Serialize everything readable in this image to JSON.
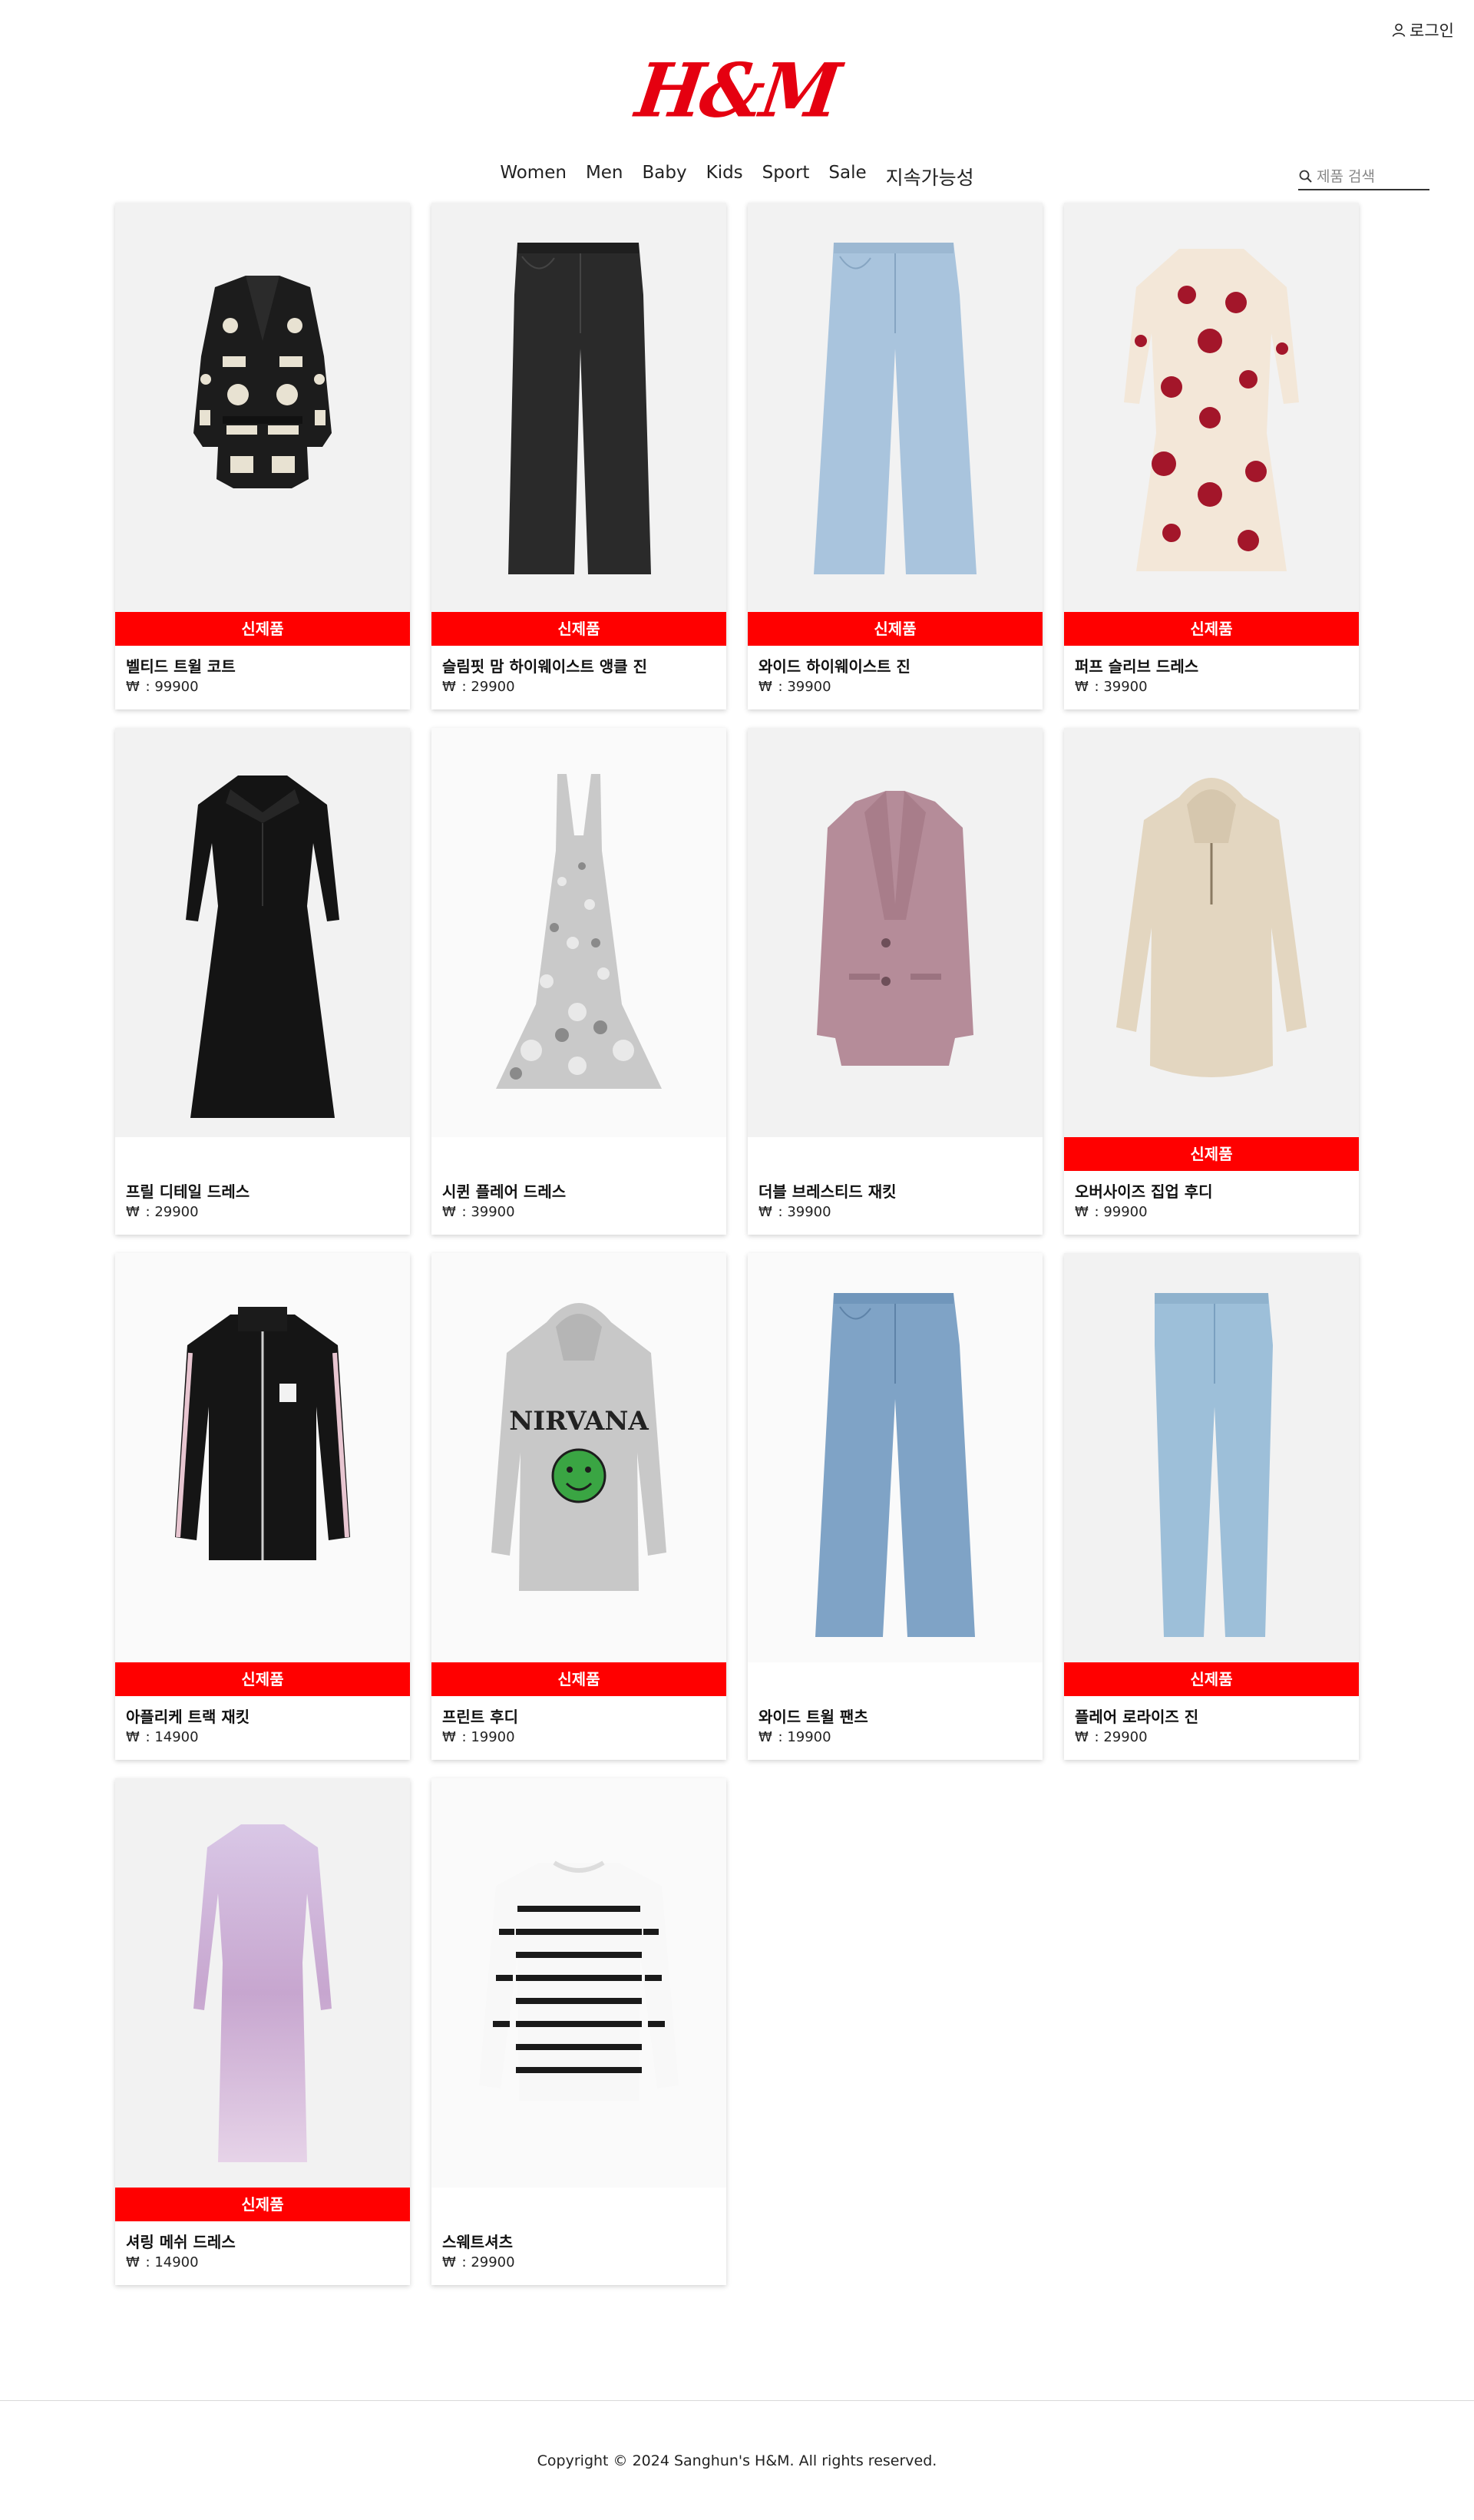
{
  "header": {
    "login_label": "로그인",
    "logo_text": "H&M",
    "brand_color": "#e50010"
  },
  "nav": {
    "items": [
      "Women",
      "Men",
      "Baby",
      "Kids",
      "Sport",
      "Sale",
      "지속가능성"
    ]
  },
  "search": {
    "placeholder": "제품 검색",
    "value": ""
  },
  "products": [
    {
      "name": "벨티드 트윌 코트",
      "currency": "₩",
      "price": "99900",
      "is_new": true,
      "badge": "신제품",
      "image": "patterned-jacket"
    },
    {
      "name": "슬림핏 맘 하이웨이스트 앵클 진",
      "currency": "₩",
      "price": "29900",
      "is_new": true,
      "badge": "신제품",
      "image": "black-jeans"
    },
    {
      "name": "와이드 하이웨이스트 진",
      "currency": "₩",
      "price": "39900",
      "is_new": true,
      "badge": "신제품",
      "image": "light-wide-jeans"
    },
    {
      "name": "퍼프 슬리브 드레스",
      "currency": "₩",
      "price": "39900",
      "is_new": true,
      "badge": "신제품",
      "image": "red-print-dress"
    },
    {
      "name": "프릴 디테일 드레스",
      "currency": "₩",
      "price": "29900",
      "is_new": false,
      "badge": "",
      "image": "black-dress"
    },
    {
      "name": "시퀸 플레어 드레스",
      "currency": "₩",
      "price": "39900",
      "is_new": false,
      "badge": "",
      "image": "sequin-dress"
    },
    {
      "name": "더블 브레스티드 재킷",
      "currency": "₩",
      "price": "39900",
      "is_new": false,
      "badge": "",
      "image": "pink-blazer"
    },
    {
      "name": "오버사이즈 집업 후디",
      "currency": "₩",
      "price": "99900",
      "is_new": true,
      "badge": "신제품",
      "image": "beige-hoodie"
    },
    {
      "name": "아플리케 트랙 재킷",
      "currency": "₩",
      "price": "14900",
      "is_new": true,
      "badge": "신제품",
      "image": "track-jacket"
    },
    {
      "name": "프린트 후디",
      "currency": "₩",
      "price": "19900",
      "is_new": true,
      "badge": "신제품",
      "image": "nirvana-hoodie"
    },
    {
      "name": "와이드 트윌 팬츠",
      "currency": "₩",
      "price": "19900",
      "is_new": false,
      "badge": "",
      "image": "wide-jeans"
    },
    {
      "name": "플레어 로라이즈 진",
      "currency": "₩",
      "price": "29900",
      "is_new": true,
      "badge": "신제품",
      "image": "skinny-jeans"
    },
    {
      "name": "셔링 메쉬 드레스",
      "currency": "₩",
      "price": "14900",
      "is_new": true,
      "badge": "신제품",
      "image": "mesh-dress"
    },
    {
      "name": "스웨트셔츠",
      "currency": "₩",
      "price": "29900",
      "is_new": false,
      "badge": "",
      "image": "striped-sweatshirt"
    }
  ],
  "footer": {
    "copyright": "Copyright © 2024 Sanghun's H&M. All rights reserved."
  },
  "colors": {
    "badge_bg": "#ff0000",
    "badge_text": "#ffffff"
  }
}
